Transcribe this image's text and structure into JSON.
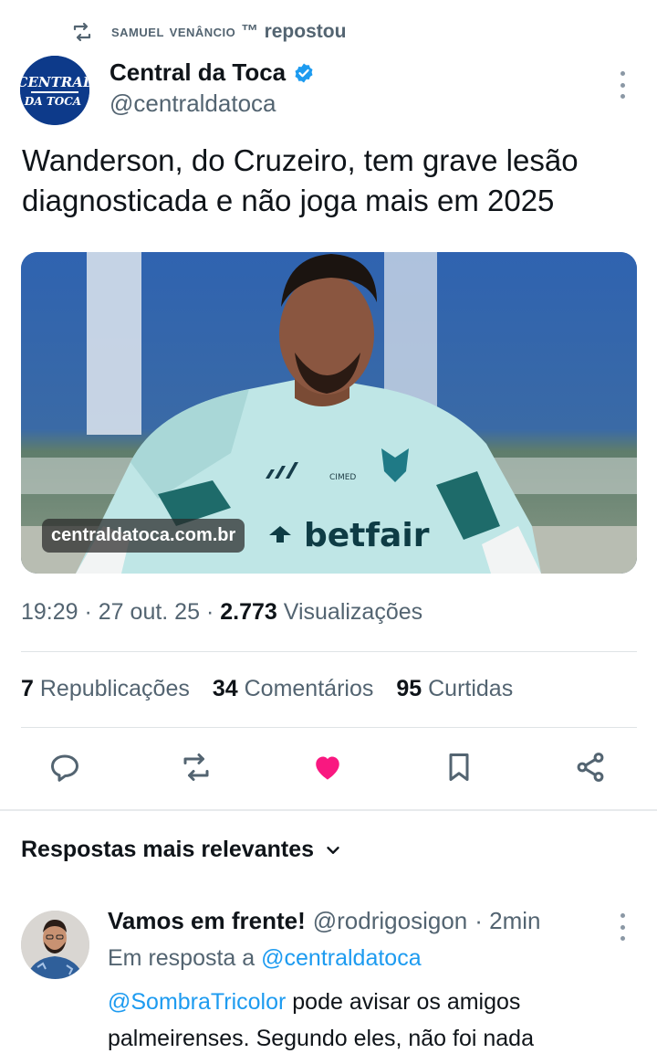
{
  "repost": {
    "name": "SAMUEL VENÂNCIO ™",
    "verb": "repostou",
    "icon": "repost-icon"
  },
  "author": {
    "name": "Central da Toca",
    "handle": "@centraldatoca",
    "verified": true,
    "logo_line1": "CENTRAL",
    "logo_line2": "DA TOCA"
  },
  "tweet": {
    "text": "Wanderson, do Cruzeiro, tem grave lesão diagnosticada e não joga mais em 2025",
    "media_link": "centraldatoca.com.br",
    "shirt_brand": "CIMED",
    "shirt_sponsor": "betfair"
  },
  "meta": {
    "time": "19:29",
    "date": "27 out. 25",
    "views": "2.773",
    "views_label": "Visualizações"
  },
  "stats": {
    "reposts": "7",
    "reposts_label": "Republicações",
    "comments": "34",
    "comments_label": "Comentários",
    "likes": "95",
    "likes_label": "Curtidas"
  },
  "colors": {
    "like": "#f91880",
    "link": "#1d9bf0",
    "muted": "#536471",
    "verified": "#1d9bf0"
  },
  "replies_section": {
    "label": "Respostas mais relevantes"
  },
  "reply": {
    "name": "Vamos em frente!",
    "handle": "@rodrigosigon",
    "time": "· 2min",
    "reply_to_prefix": "Em resposta a",
    "reply_to_handle": "@centraldatoca",
    "mention": "@SombraTricolor",
    "text": " pode avisar os amigos palmeirenses. Segundo eles, não foi nada"
  }
}
